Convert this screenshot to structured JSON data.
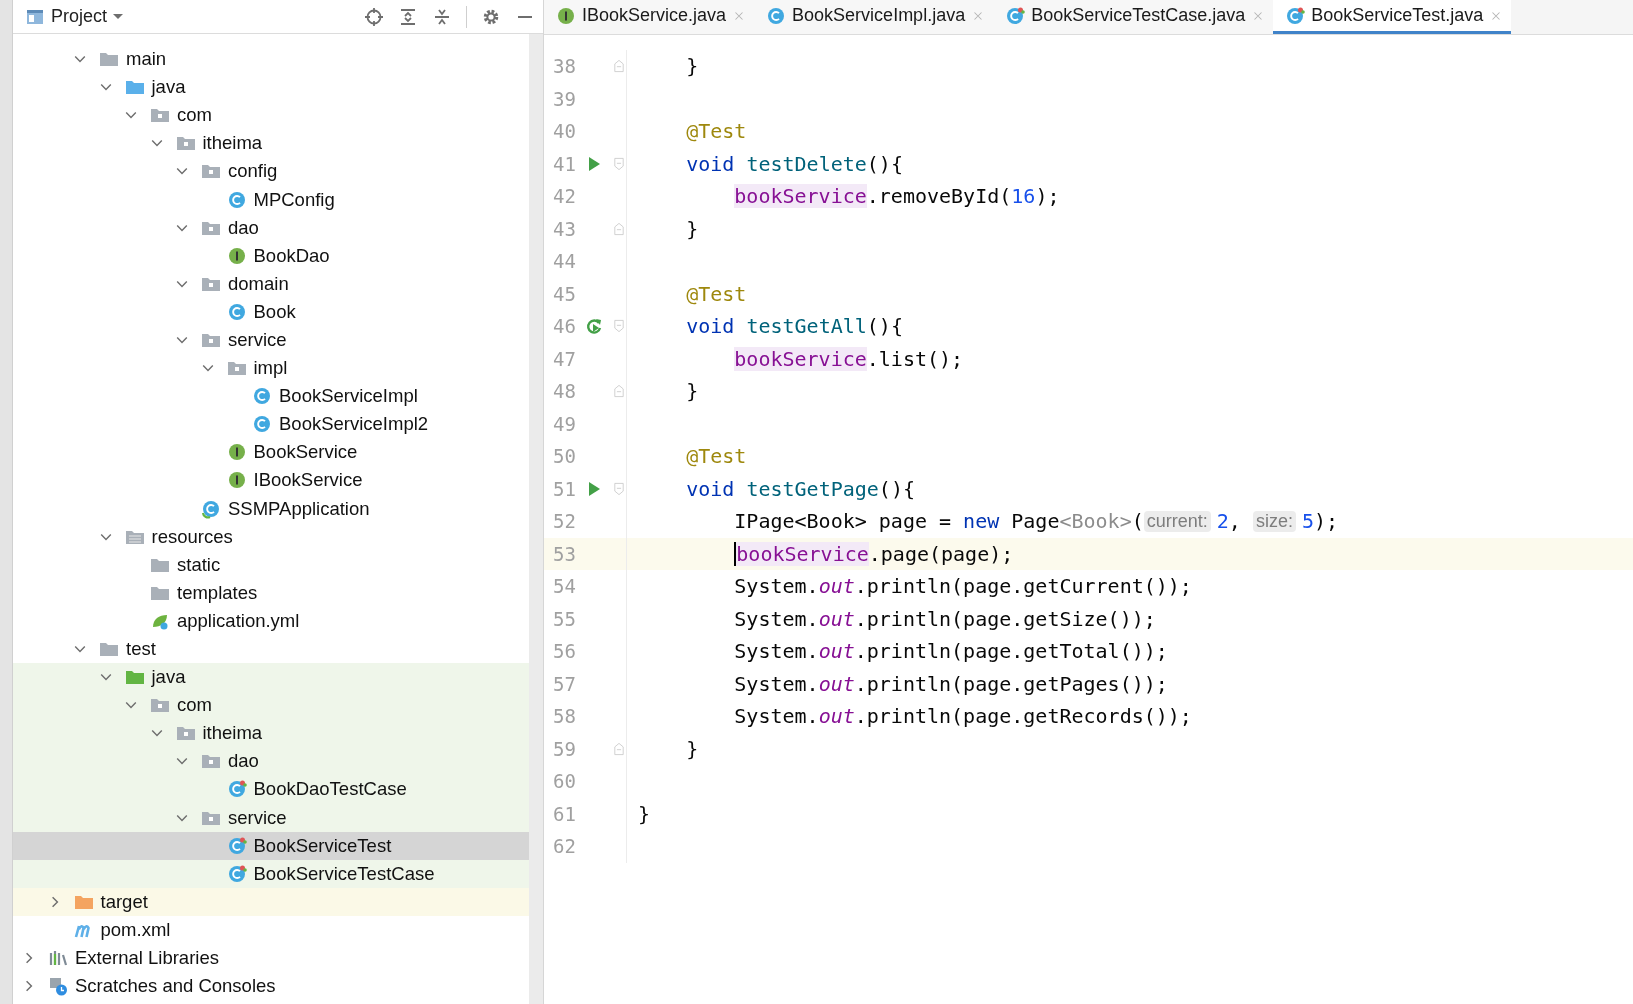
{
  "project_panel": {
    "title": "Project",
    "tree": [
      {
        "children": [
          {
            "children": [
              {
                "label": "main",
                "kind": "folder",
                "expanded": true,
                "selected": false,
                "children": [
                  {
                    "label": "java",
                    "kind": "src-folder",
                    "expanded": true,
                    "selected": false,
                    "children": [
                      {
                        "label": "com",
                        "kind": "package",
                        "expanded": true,
                        "selected": false,
                        "children": [
                          {
                            "label": "itheima",
                            "kind": "package",
                            "expanded": true,
                            "selected": false,
                            "children": [
                              {
                                "label": "config",
                                "kind": "package",
                                "expanded": true,
                                "selected": false,
                                "children": [
                                  {
                                    "label": "MPConfig",
                                    "kind": "class",
                                    "selected": false
                                  }
                                ]
                              },
                              {
                                "label": "dao",
                                "kind": "package",
                                "expanded": true,
                                "selected": false,
                                "children": [
                                  {
                                    "label": "BookDao",
                                    "kind": "interface",
                                    "selected": false
                                  }
                                ]
                              },
                              {
                                "label": "domain",
                                "kind": "package",
                                "expanded": true,
                                "selected": false,
                                "children": [
                                  {
                                    "label": "Book",
                                    "kind": "class",
                                    "selected": false
                                  }
                                ]
                              },
                              {
                                "label": "service",
                                "kind": "package",
                                "expanded": true,
                                "selected": false,
                                "children": [
                                  {
                                    "label": "impl",
                                    "kind": "package",
                                    "expanded": true,
                                    "selected": false,
                                    "children": [
                                      {
                                        "label": "BookServiceImpl",
                                        "kind": "class",
                                        "selected": false
                                      },
                                      {
                                        "label": "BookServiceImpl2",
                                        "kind": "class",
                                        "selected": false
                                      }
                                    ]
                                  },
                                  {
                                    "label": "BookService",
                                    "kind": "interface",
                                    "selected": false
                                  },
                                  {
                                    "label": "IBookService",
                                    "kind": "interface",
                                    "selected": false
                                  }
                                ]
                              },
                              {
                                "label": "SSMPApplication",
                                "kind": "spring-class",
                                "selected": false
                              }
                            ]
                          }
                        ]
                      }
                    ]
                  },
                  {
                    "label": "resources",
                    "kind": "res-folder",
                    "expanded": true,
                    "selected": false,
                    "children": [
                      {
                        "label": "static",
                        "kind": "folder",
                        "selected": false
                      },
                      {
                        "label": "templates",
                        "kind": "folder",
                        "selected": false
                      },
                      {
                        "label": "application.yml",
                        "kind": "yml",
                        "selected": false
                      }
                    ]
                  }
                ]
              },
              {
                "label": "test",
                "kind": "folder",
                "expanded": true,
                "selected": false,
                "children": [
                  {
                    "label": "java",
                    "kind": "test-folder",
                    "expanded": true,
                    "selected": false,
                    "test_source": true,
                    "children": [
                      {
                        "label": "com",
                        "kind": "package",
                        "expanded": true,
                        "selected": false,
                        "test_source": true,
                        "children": [
                          {
                            "label": "itheima",
                            "kind": "package",
                            "expanded": true,
                            "selected": false,
                            "test_source": true,
                            "children": [
                              {
                                "label": "dao",
                                "kind": "package",
                                "expanded": true,
                                "selected": false,
                                "test_source": true,
                                "children": [
                                  {
                                    "label": "BookDaoTestCase",
                                    "kind": "test-class",
                                    "selected": false,
                                    "test_source": true
                                  }
                                ]
                              },
                              {
                                "label": "service",
                                "kind": "package",
                                "expanded": true,
                                "selected": false,
                                "test_source": true,
                                "children": [
                                  {
                                    "label": "BookServiceTest",
                                    "kind": "test-class",
                                    "selected": true,
                                    "test_source": true
                                  },
                                  {
                                    "label": "BookServiceTestCase",
                                    "kind": "test-class",
                                    "selected": false,
                                    "test_source": true
                                  }
                                ]
                              }
                            ]
                          }
                        ]
                      }
                    ]
                  }
                ]
              }
            ]
          },
          {
            "label": "target",
            "kind": "excluded-folder",
            "expanded": false,
            "selected": false,
            "excluded": true
          },
          {
            "label": "pom.xml",
            "kind": "maven",
            "selected": false
          }
        ]
      },
      {
        "label": "External Libraries",
        "kind": "libraries",
        "expanded": false,
        "selected": false
      },
      {
        "label": "Scratches and Consoles",
        "kind": "scratches",
        "expanded": false,
        "selected": false
      }
    ]
  },
  "tabs": [
    {
      "label": "IBookService.java",
      "kind": "interface",
      "selected": false
    },
    {
      "label": "BookServiceImpl.java",
      "kind": "class",
      "selected": false
    },
    {
      "label": "BookServiceTestCase.java",
      "kind": "test-class",
      "selected": false
    },
    {
      "label": "BookServiceTest.java",
      "kind": "test-class",
      "selected": true
    }
  ],
  "editor": {
    "lines": [
      {
        "number": "38",
        "fold": {
          "kind": "end"
        },
        "tokens": [
          {
            "kind": "plain",
            "text": "    }"
          }
        ]
      },
      {
        "number": "39"
      },
      {
        "number": "40",
        "tokens": [
          {
            "kind": "annotation",
            "text": "    @Test"
          }
        ]
      },
      {
        "number": "41",
        "gutter_icon": {
          "kind": "run"
        },
        "fold": {
          "kind": "start"
        },
        "tokens": [
          {
            "kind": "keyword",
            "text": "    void "
          },
          {
            "kind": "declaration",
            "text": "testDelete"
          },
          {
            "kind": "plain",
            "text": "(){"
          }
        ]
      },
      {
        "number": "42",
        "tokens": [
          {
            "kind": "field",
            "text": "        bookService"
          },
          {
            "kind": "plain",
            "text": ".removeById("
          },
          {
            "kind": "number",
            "text": "16"
          },
          {
            "kind": "plain",
            "text": ");"
          }
        ]
      },
      {
        "number": "43",
        "fold": {
          "kind": "end"
        },
        "tokens": [
          {
            "kind": "plain",
            "text": "    }"
          }
        ]
      },
      {
        "number": "44"
      },
      {
        "number": "45",
        "tokens": [
          {
            "kind": "annotation",
            "text": "    @Test"
          }
        ]
      },
      {
        "number": "46",
        "gutter_icon": {
          "kind": "rerun"
        },
        "fold": {
          "kind": "start"
        },
        "tokens": [
          {
            "kind": "keyword",
            "text": "    void "
          },
          {
            "kind": "declaration",
            "text": "testGetAll"
          },
          {
            "kind": "plain",
            "text": "(){"
          }
        ]
      },
      {
        "number": "47",
        "tokens": [
          {
            "kind": "field",
            "text": "        bookService"
          },
          {
            "kind": "plain",
            "text": ".list();"
          }
        ]
      },
      {
        "number": "48",
        "fold": {
          "kind": "end"
        },
        "tokens": [
          {
            "kind": "plain",
            "text": "    }"
          }
        ]
      },
      {
        "number": "49"
      },
      {
        "number": "50",
        "tokens": [
          {
            "kind": "annotation",
            "text": "    @Test"
          }
        ]
      },
      {
        "number": "51",
        "gutter_icon": {
          "kind": "run"
        },
        "fold": {
          "kind": "start"
        },
        "tokens": [
          {
            "kind": "keyword",
            "text": "    void "
          },
          {
            "kind": "declaration",
            "text": "testGetPage"
          },
          {
            "kind": "plain",
            "text": "(){"
          }
        ]
      },
      {
        "number": "52",
        "tokens": [
          {
            "kind": "plain",
            "text": "        IPage<Book> page = "
          },
          {
            "kind": "keyword",
            "text": "new"
          },
          {
            "kind": "plain",
            "text": " Page"
          },
          {
            "kind": "inferred",
            "text": "<Book>"
          },
          {
            "kind": "plain",
            "text": "("
          },
          {
            "kind": "hint",
            "text": "current:"
          },
          {
            "kind": "number",
            "text": "2"
          },
          {
            "kind": "plain",
            "text": ", "
          },
          {
            "kind": "hint",
            "text": "size:"
          },
          {
            "kind": "number",
            "text": "5"
          },
          {
            "kind": "plain",
            "text": ");"
          }
        ]
      },
      {
        "number": "53",
        "current": true,
        "tokens": [
          {
            "kind": "field",
            "text": "        bookService"
          },
          {
            "kind": "plain",
            "text": ".page(page);"
          }
        ]
      },
      {
        "number": "54",
        "tokens": [
          {
            "kind": "plain",
            "text": "        System."
          },
          {
            "kind": "static",
            "text": "out"
          },
          {
            "kind": "plain",
            "text": ".println(page.getCurrent());"
          }
        ]
      },
      {
        "number": "55",
        "tokens": [
          {
            "kind": "plain",
            "text": "        System."
          },
          {
            "kind": "static",
            "text": "out"
          },
          {
            "kind": "plain",
            "text": ".println(page.getSize());"
          }
        ]
      },
      {
        "number": "56",
        "tokens": [
          {
            "kind": "plain",
            "text": "        System."
          },
          {
            "kind": "static",
            "text": "out"
          },
          {
            "kind": "plain",
            "text": ".println(page.getTotal());"
          }
        ]
      },
      {
        "number": "57",
        "tokens": [
          {
            "kind": "plain",
            "text": "        System."
          },
          {
            "kind": "static",
            "text": "out"
          },
          {
            "kind": "plain",
            "text": ".println(page.getPages());"
          }
        ]
      },
      {
        "number": "58",
        "tokens": [
          {
            "kind": "plain",
            "text": "        System."
          },
          {
            "kind": "static",
            "text": "out"
          },
          {
            "kind": "plain",
            "text": ".println(page.getRecords());"
          }
        ]
      },
      {
        "number": "59",
        "fold": {
          "kind": "end"
        },
        "tokens": [
          {
            "kind": "plain",
            "text": "    }"
          }
        ]
      },
      {
        "number": "60"
      },
      {
        "number": "61",
        "tokens": [
          {
            "kind": "plain",
            "text": "}"
          }
        ]
      },
      {
        "number": "62"
      }
    ]
  }
}
